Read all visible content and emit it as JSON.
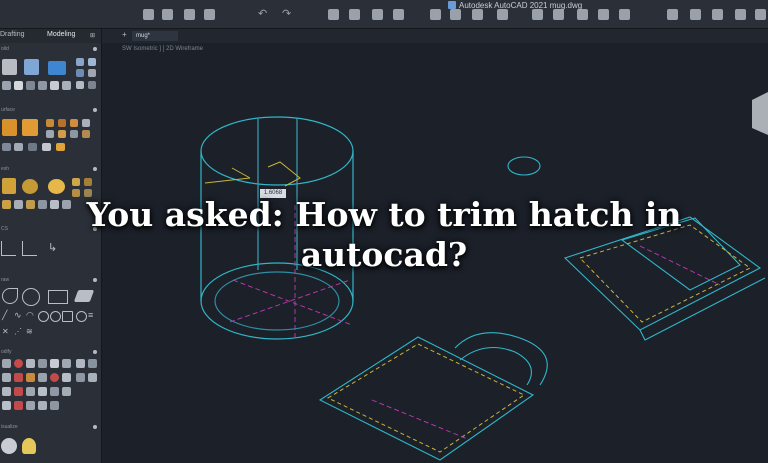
{
  "window": {
    "title": "Autodesk AutoCAD 2021  mug.dwg"
  },
  "palette": {
    "tabs": [
      "Drafting",
      "Modeling"
    ],
    "sections": [
      "olid",
      "urface",
      "esh",
      "CS",
      "raw",
      "odify",
      "isualize"
    ]
  },
  "canvas": {
    "file_tab": "mug*",
    "view_label": "SW Isometric ] [ 2D Wireframe",
    "dimension_value": "1.6068"
  },
  "headline": {
    "line1": "You asked: How to trim hatch in",
    "line2": "autocad?"
  },
  "colors": {
    "accent_cyan": "#31b6c8",
    "hatch_yellow": "#c9b43a",
    "axis_magenta": "#c43ab2",
    "background": "#1b2029"
  }
}
